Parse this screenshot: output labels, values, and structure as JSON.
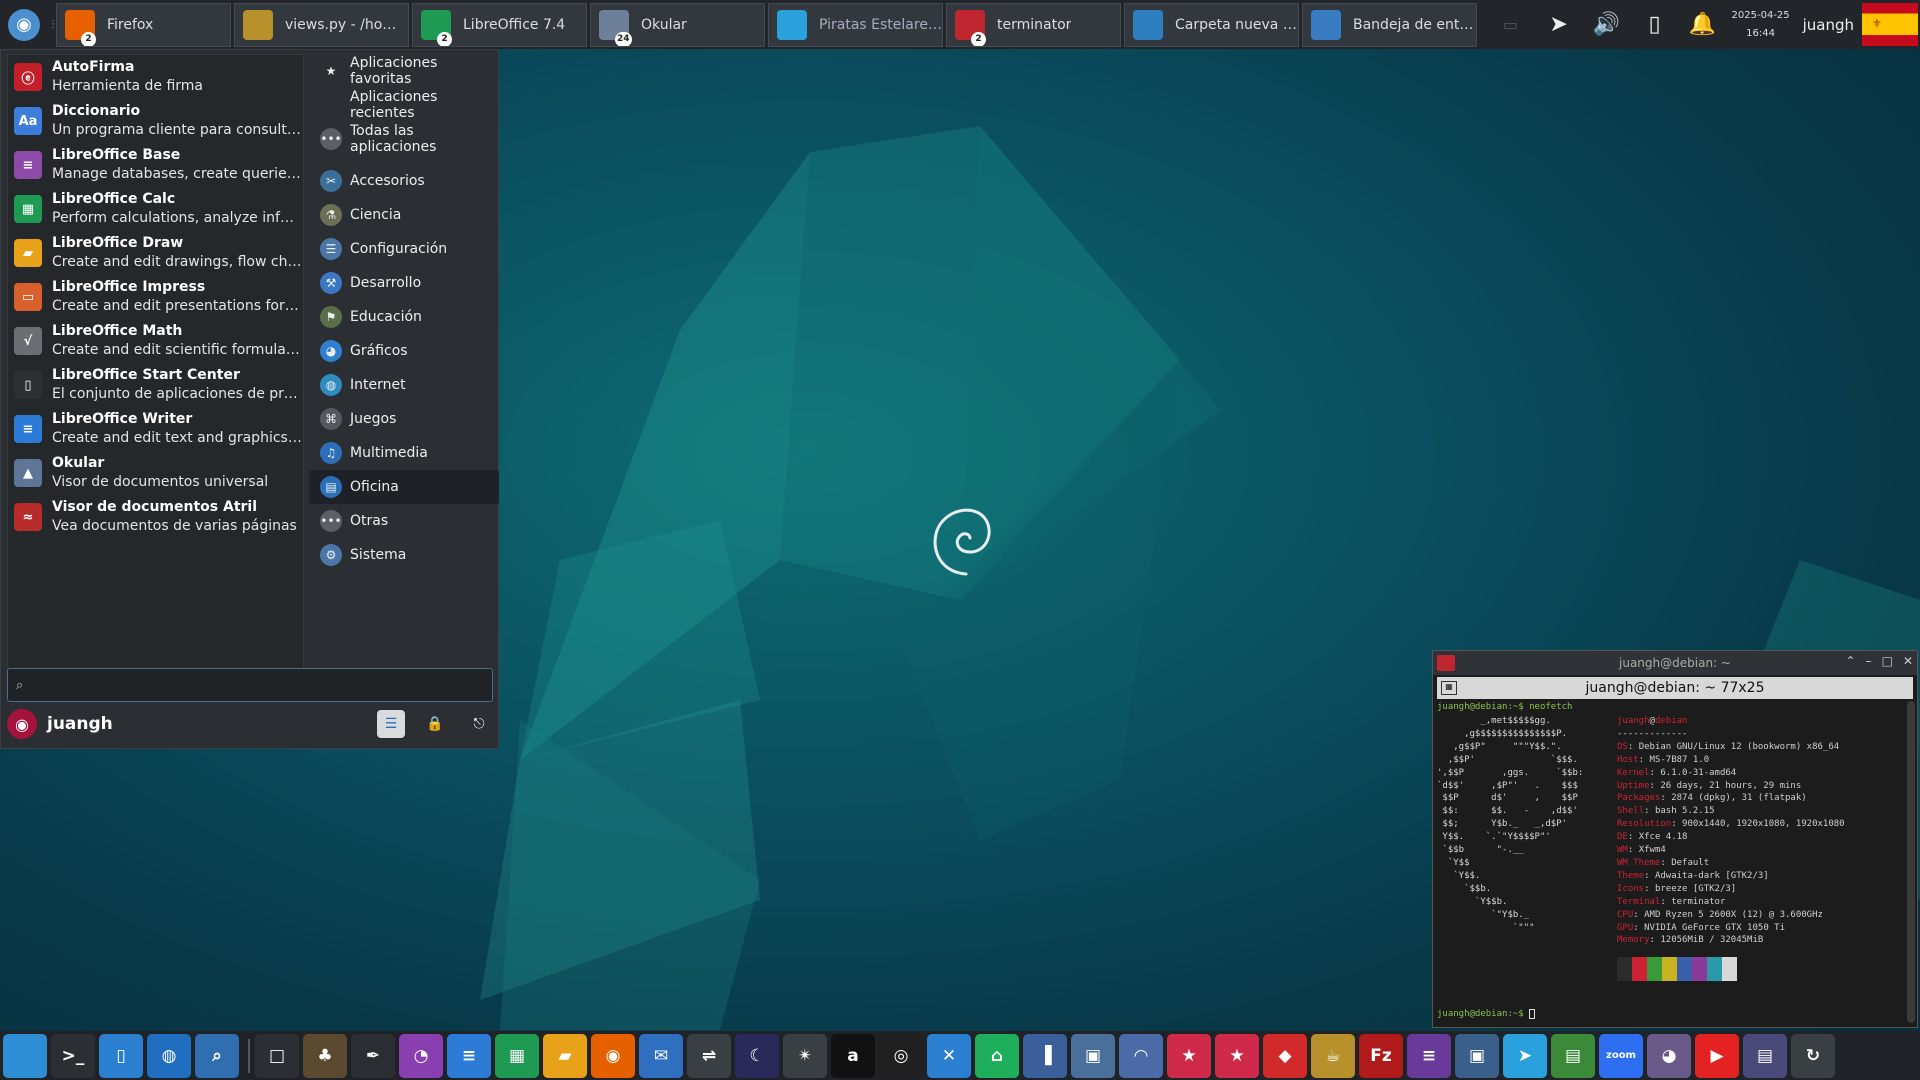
{
  "taskbar": {
    "tasks": [
      {
        "label": "Firefox",
        "icon": "firefox-icon",
        "badge": "2",
        "color": "#e66000"
      },
      {
        "label": "views.py - /home/ju...",
        "icon": "geany-teapot-icon",
        "badge": "",
        "color": "#b8902b"
      },
      {
        "label": "LibreOffice 7.4",
        "icon": "libreoffice-calc-icon",
        "badge": "2",
        "color": "#1e9a53"
      },
      {
        "label": "Okular",
        "icon": "okular-icon",
        "badge": "24",
        "color": "#6d7f99"
      },
      {
        "label": "Piratas Estelares – (...",
        "icon": "telegram-icon",
        "badge": "",
        "color": "#2aa1dc"
      },
      {
        "label": "terminator",
        "icon": "terminator-icon",
        "badge": "2",
        "color": "#c0262f"
      },
      {
        "label": "Carpeta nueva - Thu...",
        "icon": "folder-icon",
        "badge": "",
        "color": "#2d7fbf"
      },
      {
        "label": "Bandeja de entrada...",
        "icon": "thunderbird-icon",
        "badge": "",
        "color": "#3a7cc4"
      }
    ],
    "clock_date": "2025-04-25",
    "clock_time": "16:44",
    "user": "juangh"
  },
  "menu": {
    "apps": [
      {
        "name": "AutoFirma",
        "desc": "Herramienta de firma",
        "icon": "autofirma-icon",
        "color": "#c21f2a",
        "glyph": "ⓔ"
      },
      {
        "name": "Diccionario",
        "desc": "Un programa cliente para consultar disti...",
        "icon": "dictionary-icon",
        "color": "#3b7dd8",
        "glyph": "Aa"
      },
      {
        "name": "LibreOffice Base",
        "desc": "Manage databases, create queries and ...",
        "icon": "libreoffice-base-icon",
        "color": "#8e4aa8",
        "glyph": "≡"
      },
      {
        "name": "LibreOffice Calc",
        "desc": "Perform calculations, analyze informati...",
        "icon": "libreoffice-calc-icon",
        "color": "#1e9a53",
        "glyph": "▦"
      },
      {
        "name": "LibreOffice Draw",
        "desc": "Create and edit drawings, flow charts a...",
        "icon": "libreoffice-draw-icon",
        "color": "#e8a21a",
        "glyph": "▰"
      },
      {
        "name": "LibreOffice Impress",
        "desc": "Create and edit presentations for slides...",
        "icon": "libreoffice-impress-icon",
        "color": "#d9602c",
        "glyph": "▭"
      },
      {
        "name": "LibreOffice Math",
        "desc": "Create and edit scientific formulas and ...",
        "icon": "libreoffice-math-icon",
        "color": "#6b6f73",
        "glyph": "√"
      },
      {
        "name": "LibreOffice Start Center",
        "desc": "El conjunto de aplicaciones de productiv...",
        "icon": "libreoffice-start-icon",
        "color": "#2d2f31",
        "glyph": "▯"
      },
      {
        "name": "LibreOffice Writer",
        "desc": "Create and edit text and graphics in lett...",
        "icon": "libreoffice-writer-icon",
        "color": "#2c7bd6",
        "glyph": "≡"
      },
      {
        "name": "Okular",
        "desc": "Visor de documentos universal",
        "icon": "okular-icon",
        "color": "#5f7596",
        "glyph": "▲"
      },
      {
        "name": "Visor de documentos Atril",
        "desc": "Vea documentos de varias páginas",
        "icon": "atril-icon",
        "color": "#b82b2b",
        "glyph": "≈"
      }
    ],
    "categories_top": [
      {
        "label": "Aplicaciones favoritas",
        "icon": "star-icon",
        "color": "#2b2f33",
        "glyph": "★"
      },
      {
        "label": "Aplicaciones recientes",
        "icon": "recent-icon",
        "color": "#2b2f33",
        "glyph": ""
      },
      {
        "label": "Todas las aplicaciones",
        "icon": "all-apps-icon",
        "color": "#5c6066",
        "glyph": "•••"
      }
    ],
    "categories": [
      {
        "label": "Accesorios",
        "icon": "accessories-icon",
        "color": "#3a6f9a",
        "glyph": "✂"
      },
      {
        "label": "Ciencia",
        "icon": "science-icon",
        "color": "#6a6f56",
        "glyph": "⚗"
      },
      {
        "label": "Configuración",
        "icon": "settings-icon",
        "color": "#4a76a8",
        "glyph": "☰"
      },
      {
        "label": "Desarrollo",
        "icon": "development-icon",
        "color": "#3a78c4",
        "glyph": "⚒"
      },
      {
        "label": "Educación",
        "icon": "education-icon",
        "color": "#5a6e4a",
        "glyph": "⚑"
      },
      {
        "label": "Gráficos",
        "icon": "graphics-icon",
        "color": "#2f80d0",
        "glyph": "◕"
      },
      {
        "label": "Internet",
        "icon": "internet-icon",
        "color": "#2e8bbd",
        "glyph": "◍"
      },
      {
        "label": "Juegos",
        "icon": "games-icon",
        "color": "#55595e",
        "glyph": "⌘"
      },
      {
        "label": "Multimedia",
        "icon": "multimedia-icon",
        "color": "#2c6fb8",
        "glyph": "♫"
      },
      {
        "label": "Oficina",
        "icon": "office-icon",
        "color": "#2c6fb8",
        "glyph": "▤"
      },
      {
        "label": "Otras",
        "icon": "other-icon",
        "color": "#5c6066",
        "glyph": "•••"
      },
      {
        "label": "Sistema",
        "icon": "system-icon",
        "color": "#4a76a8",
        "glyph": "⚙"
      }
    ],
    "active_category": "Oficina",
    "search_value": "",
    "user": "juangh"
  },
  "terminal": {
    "window_title": "juangh@debian: ~",
    "tab_title": "juangh@debian: ~ 77x25",
    "prompt": "juangh@debian:~$ neofetch",
    "header_user": "juangh",
    "header_at": "@",
    "header_host": "debian",
    "separator": "-------------",
    "info": [
      {
        "key": "OS",
        "value": "Debian GNU/Linux 12 (bookworm) x86_64"
      },
      {
        "key": "Host",
        "value": "MS-7B87 1.0"
      },
      {
        "key": "Kernel",
        "value": "6.1.0-31-amd64"
      },
      {
        "key": "Uptime",
        "value": "26 days, 21 hours, 29 mins"
      },
      {
        "key": "Packages",
        "value": "2874 (dpkg), 31 (flatpak)"
      },
      {
        "key": "Shell",
        "value": "bash 5.2.15"
      },
      {
        "key": "Resolution",
        "value": "900x1440, 1920x1080, 1920x1080"
      },
      {
        "key": "DE",
        "value": "Xfce 4.18"
      },
      {
        "key": "WM",
        "value": "Xfwm4"
      },
      {
        "key": "WM Theme",
        "value": "Default"
      },
      {
        "key": "Theme",
        "value": "Adwaita-dark [GTK2/3]"
      },
      {
        "key": "Icons",
        "value": "breeze [GTK2/3]"
      },
      {
        "key": "Terminal",
        "value": "terminator"
      },
      {
        "key": "CPU",
        "value": "AMD Ryzen 5 2600X (12) @ 3.600GHz"
      },
      {
        "key": "GPU",
        "value": "NVIDIA GeForce GTX 1050 Ti"
      },
      {
        "key": "Memory",
        "value": "12056MiB / 32045MiB"
      }
    ],
    "ascii": "        _,met$$$$$gg.\n     ,g$$$$$$$$$$$$$$$P.\n   ,g$$P\"     \"\"\"Y$$.\".\n  ,$$P'              `$$$.\n',$$P       ,ggs.     `$$b:\n`d$$'     ,$P\"'   .    $$$\n $$P      d$'     ,    $$P\n $$:      $$.   -    ,d$$'\n $$;      Y$b._   _,d$P'\n Y$$.    `.`\"Y$$$$P\"'\n `$$b      \"-.__\n  `Y$$\n   `Y$$.\n     `$$b.\n       `Y$$b.\n          `\"Y$b._\n              `\"\"\"",
    "palette": [
      "#2b2b2b",
      "#cc2233",
      "#3a9a3a",
      "#c9b320",
      "#3a5fa8",
      "#8a3a9a",
      "#2a9aa8",
      "#d8d8d8"
    ],
    "prompt_end": "juangh@debian:~$ "
  },
  "dock": {
    "icons": [
      {
        "name": "show-desktop-icon",
        "color": "#2d8ed6",
        "glyph": ""
      },
      {
        "name": "terminal-icon",
        "color": "#2b2f33",
        "glyph": ">_"
      },
      {
        "name": "file-manager-icon",
        "color": "#2a7fd0",
        "glyph": "▯"
      },
      {
        "name": "web-browser-icon",
        "color": "#1f6ec0",
        "glyph": "◍"
      },
      {
        "name": "app-finder-icon",
        "color": "#2f6fb0",
        "glyph": "⌕"
      },
      {
        "name": "separator",
        "color": "",
        "glyph": ""
      },
      {
        "name": "files-icon",
        "color": "#2b2f33",
        "glyph": "□"
      },
      {
        "name": "gimp-icon",
        "color": "#5b4a2f",
        "glyph": "♣"
      },
      {
        "name": "inkscape-icon",
        "color": "#2b2f33",
        "glyph": "✒"
      },
      {
        "name": "krita-icon",
        "color": "#8a3fb0",
        "glyph": "◔"
      },
      {
        "name": "libreoffice-writer-icon",
        "color": "#2c7bd6",
        "glyph": "≡"
      },
      {
        "name": "libreoffice-calc-icon",
        "color": "#1e9a53",
        "glyph": "▦"
      },
      {
        "name": "libreoffice-draw-icon",
        "color": "#e8a21a",
        "glyph": "▰"
      },
      {
        "name": "firefox-icon",
        "color": "#e66000",
        "glyph": "◉"
      },
      {
        "name": "thunderbird-icon",
        "color": "#2f6fc0",
        "glyph": "✉"
      },
      {
        "name": "usb-writer-icon",
        "color": "#3a3f44",
        "glyph": "⇌"
      },
      {
        "name": "stellarium-icon",
        "color": "#2a2a5a",
        "glyph": "☾"
      },
      {
        "name": "telescope-icon",
        "color": "#3a3f44",
        "glyph": "✴"
      },
      {
        "name": "amazon-icon",
        "color": "#111111",
        "glyph": "a"
      },
      {
        "name": "obs-icon",
        "color": "#202020",
        "glyph": "◎"
      },
      {
        "name": "remote-desktop-icon",
        "color": "#2a7fd0",
        "glyph": "✕"
      },
      {
        "name": "home-app-icon",
        "color": "#1fae5b",
        "glyph": "⌂"
      },
      {
        "name": "audio-editor-icon",
        "color": "#3a5f9a",
        "glyph": "▐"
      },
      {
        "name": "video-editor-icon",
        "color": "#4a6f9a",
        "glyph": "▣"
      },
      {
        "name": "flathub-icon",
        "color": "#4a6aa8",
        "glyph": "◠"
      },
      {
        "name": "kstars-icon",
        "color": "#d02a4a",
        "glyph": "★"
      },
      {
        "name": "kstars-alt-icon",
        "color": "#d02a4a",
        "glyph": "★"
      },
      {
        "name": "anydesk-icon",
        "color": "#d02a2a",
        "glyph": "◆"
      },
      {
        "name": "geany-icon",
        "color": "#b8902b",
        "glyph": "☕"
      },
      {
        "name": "filezilla-icon",
        "color": "#b01a1a",
        "glyph": "Fz"
      },
      {
        "name": "notes-icon",
        "color": "#6a3a9a",
        "glyph": "≡"
      },
      {
        "name": "screenshot-icon",
        "color": "#3a5f8a",
        "glyph": "▣"
      },
      {
        "name": "telegram-icon",
        "color": "#2aa1dc",
        "glyph": "➤"
      },
      {
        "name": "cubic-icon",
        "color": "#3a8a3a",
        "glyph": "▤"
      },
      {
        "name": "zoom-icon",
        "color": "#2d6ff0",
        "glyph": "zoom"
      },
      {
        "name": "pidgin-icon",
        "color": "#6a5a8a",
        "glyph": "◕"
      },
      {
        "name": "youtube-icon",
        "color": "#e52222",
        "glyph": "▶"
      },
      {
        "name": "image-viewer-icon",
        "color": "#4a4a7a",
        "glyph": "▤"
      },
      {
        "name": "timeshift-icon",
        "color": "#3a3f44",
        "glyph": "↻"
      }
    ]
  }
}
